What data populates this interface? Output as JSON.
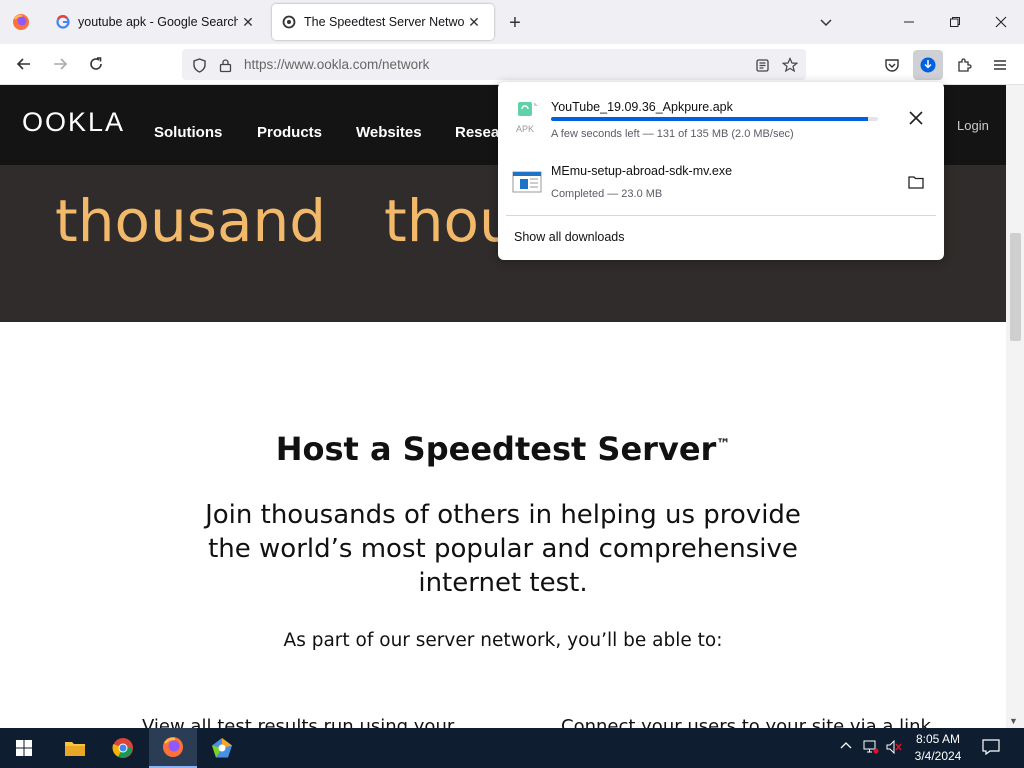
{
  "browser": {
    "tabs": [
      {
        "title": "youtube apk - Google Search"
      },
      {
        "title": "The Speedtest Server Network™"
      }
    ],
    "url": "https://www.ookla.com/network"
  },
  "site": {
    "logo": "OOKLA",
    "nav": [
      "Solutions",
      "Products",
      "Websites",
      "Resea"
    ],
    "login": "Login",
    "hero_words": [
      "thousand",
      "thou"
    ],
    "heading": "Host a Speedtest Server",
    "heading_tm": "™",
    "lead": "Join thousands of others in helping us provide the world’s most popular and comprehensive internet test.",
    "sub": "As part of our server network, you’ll be able to:",
    "cut_left": "View all test results run using your",
    "cut_right": "Connect your users to your site via a link"
  },
  "downloads": {
    "items": [
      {
        "name": "YouTube_19.09.36_Apkpure.apk",
        "status": "A few seconds left — 131 of 135 MB (2.0 MB/sec)",
        "progress": 0.97,
        "icon_label": "APK"
      },
      {
        "name": "MEmu-setup-abroad-sdk-mv.exe",
        "status": "Completed — 23.0 MB"
      }
    ],
    "show_all": "Show all downloads"
  },
  "taskbar": {
    "time": "8:05 AM",
    "date": "3/4/2024"
  },
  "colors": {
    "accent": "#0061e0",
    "hero_text": "#f2b96b",
    "header_bg": "#141414",
    "hero_bg": "#302c2b",
    "taskbar_bg": "#0e1d2f"
  }
}
